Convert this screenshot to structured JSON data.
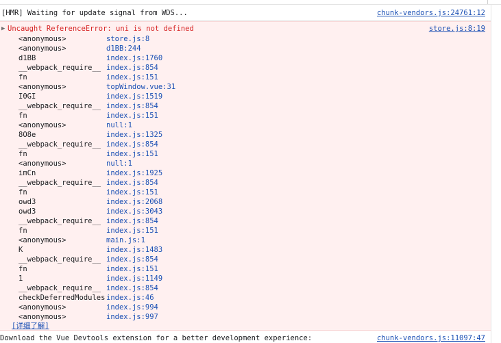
{
  "hmr": {
    "text": "[HMR] Waiting for update signal from WDS...",
    "source": "chunk-vendors.js:24761:12"
  },
  "error": {
    "expand_icon": "triangle-right-icon",
    "message": "Uncaught ReferenceError: uni is not defined",
    "source": "store.js:8:19",
    "stack": [
      {
        "fn": "<anonymous>",
        "loc": "store.js:8"
      },
      {
        "fn": "<anonymous>",
        "loc": "d1BB:244"
      },
      {
        "fn": "d1BB",
        "loc": "index.js:1760"
      },
      {
        "fn": "__webpack_require__",
        "loc": "index.js:854"
      },
      {
        "fn": "fn",
        "loc": "index.js:151"
      },
      {
        "fn": "<anonymous>",
        "loc": "topWindow.vue:31"
      },
      {
        "fn": "I0GI",
        "loc": "index.js:1519"
      },
      {
        "fn": "__webpack_require__",
        "loc": "index.js:854"
      },
      {
        "fn": "fn",
        "loc": "index.js:151"
      },
      {
        "fn": "<anonymous>",
        "loc": "null:1"
      },
      {
        "fn": "8O8e",
        "loc": "index.js:1325"
      },
      {
        "fn": "__webpack_require__",
        "loc": "index.js:854"
      },
      {
        "fn": "fn",
        "loc": "index.js:151"
      },
      {
        "fn": "<anonymous>",
        "loc": "null:1"
      },
      {
        "fn": "imCn",
        "loc": "index.js:1925"
      },
      {
        "fn": "__webpack_require__",
        "loc": "index.js:854"
      },
      {
        "fn": "fn",
        "loc": "index.js:151"
      },
      {
        "fn": "owd3",
        "loc": "index.js:2068"
      },
      {
        "fn": "owd3",
        "loc": "index.js:3043"
      },
      {
        "fn": "__webpack_require__",
        "loc": "index.js:854"
      },
      {
        "fn": "fn",
        "loc": "index.js:151"
      },
      {
        "fn": "<anonymous>",
        "loc": "main.js:1"
      },
      {
        "fn": "K",
        "loc": "index.js:1483"
      },
      {
        "fn": "__webpack_require__",
        "loc": "index.js:854"
      },
      {
        "fn": "fn",
        "loc": "index.js:151"
      },
      {
        "fn": "1",
        "loc": "index.js:1149"
      },
      {
        "fn": "__webpack_require__",
        "loc": "index.js:854"
      },
      {
        "fn": "checkDeferredModules",
        "loc": "index.js:46"
      },
      {
        "fn": "<anonymous>",
        "loc": "index.js:994"
      },
      {
        "fn": "<anonymous>",
        "loc": "index.js:997"
      }
    ],
    "more_link": "[详细了解]"
  },
  "vue_tip": {
    "text": "Download the Vue Devtools extension for a better development experience:",
    "source": "chunk-vendors.js:11097:47"
  },
  "colors": {
    "error_bg": "#fff0f0",
    "error_text": "#d62424",
    "link": "#1a4fb4"
  }
}
